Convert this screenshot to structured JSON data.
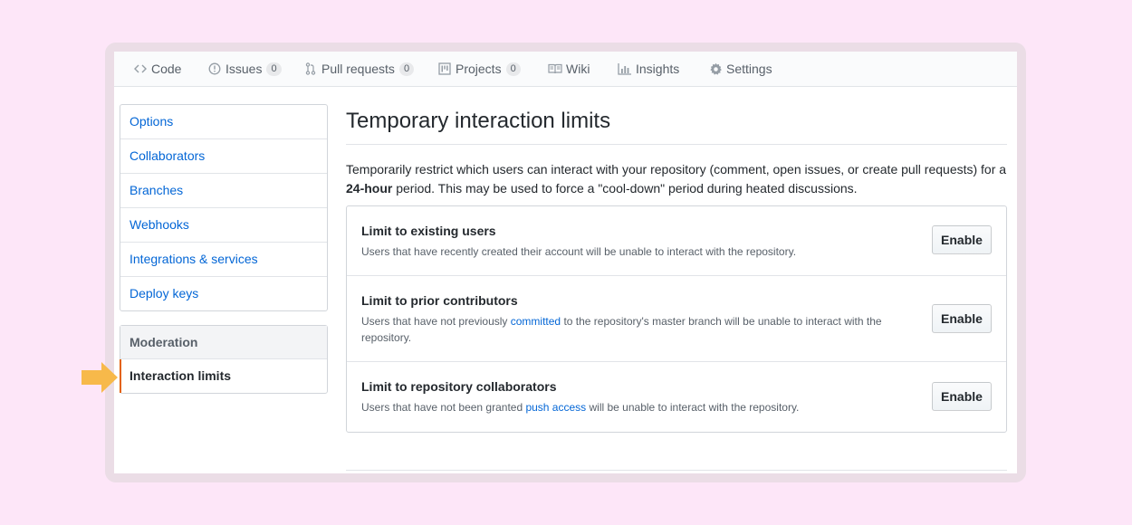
{
  "nav": {
    "items": [
      {
        "label": "Code",
        "icon": "code-icon"
      },
      {
        "label": "Issues",
        "icon": "issue-icon",
        "count": "0"
      },
      {
        "label": "Pull requests",
        "icon": "pull-request-icon",
        "count": "0"
      },
      {
        "label": "Projects",
        "icon": "project-icon",
        "count": "0"
      },
      {
        "label": "Wiki",
        "icon": "book-icon"
      },
      {
        "label": "Insights",
        "icon": "graph-icon"
      },
      {
        "label": "Settings",
        "icon": "gear-icon"
      }
    ]
  },
  "sidebar": {
    "items": [
      {
        "label": "Options"
      },
      {
        "label": "Collaborators"
      },
      {
        "label": "Branches"
      },
      {
        "label": "Webhooks"
      },
      {
        "label": "Integrations & services"
      },
      {
        "label": "Deploy keys"
      }
    ],
    "moderation": {
      "heading": "Moderation",
      "selected": "Interaction limits"
    }
  },
  "main": {
    "title": "Temporary interaction limits",
    "desc_before": "Temporarily restrict which users can interact with your repository (comment, open issues, or create pull requests) for a ",
    "desc_bold": "24-hour",
    "desc_after": " period. This may be used to force a \"cool-down\" period during heated discussions.",
    "options": [
      {
        "title": "Limit to existing users",
        "note": "Users that have recently created their account will be unable to interact with the repository.",
        "button": "Enable"
      },
      {
        "title": "Limit to prior contributors",
        "note_before": "Users that have not previously ",
        "note_link": "committed",
        "note_after": " to the repository's master branch will be unable to interact with the repository.",
        "button": "Enable"
      },
      {
        "title": "Limit to repository collaborators",
        "note_before": "Users that have not been granted ",
        "note_link": "push access",
        "note_after": " will be unable to interact with the repository.",
        "button": "Enable"
      }
    ]
  },
  "colors": {
    "background": "#fde6f8",
    "link": "#0366d6",
    "selected_indicator": "#e36209",
    "arrow": "#f7b94a"
  }
}
